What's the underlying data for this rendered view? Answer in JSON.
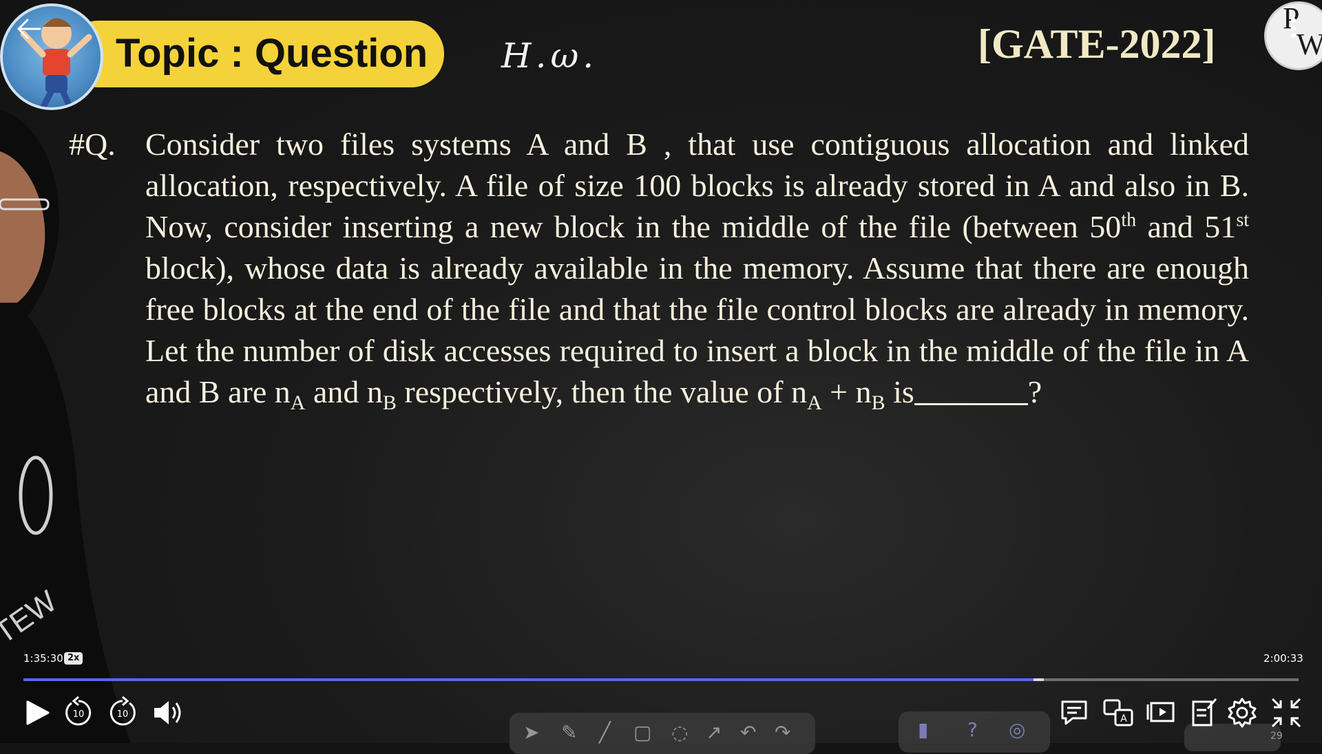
{
  "header": {
    "topic_label": "Topic : Question",
    "handwritten_note": "H.ω.",
    "exam_tag": "[GATE-2022]",
    "logo_letters": {
      "top": "P",
      "bottom": "W"
    }
  },
  "question": {
    "marker": "#Q.",
    "text_1": "Consider two files systems A and B , that use contiguous allocation and linked allocation, respectively. A file of size 100 blocks is already stored in A and also in B. Now, consider inserting a new block in the middle of the file (between 50",
    "sup_1": "th",
    "text_2": " and 51",
    "sup_2": "st",
    "text_3": " block), whose data is already available in the memory. Assume that there are enough free blocks at the end of the file and that the file control blocks are already in memory. Let the number of disk accesses required to insert a block in the middle of the file in A and B are n",
    "sub_a": "A",
    "text_4": " and n",
    "sub_b": "B",
    "text_5": " respectively, then the value of n",
    "sub_a2": "A",
    "text_6": " + n",
    "sub_b2": "B",
    "text_7": " is",
    "text_end": "?"
  },
  "player": {
    "current_time": "1:35:30",
    "speed": "2x",
    "duration": "2:00:33",
    "progress_fraction": 0.792,
    "buffered_fraction": 0.8,
    "skip_back_seconds": "10",
    "skip_forward_seconds": "10",
    "page_number": "29"
  },
  "colors": {
    "topic_pill": "#f4d23a",
    "progress_played": "#5a66ee",
    "board_text": "#f5f0de",
    "gate_text": "#f1e9c4"
  },
  "icons": [
    "back-arrow-icon",
    "kebab-menu-icon",
    "play-icon",
    "rewind-10-icon",
    "forward-10-icon",
    "volume-icon",
    "chat-icon",
    "translate-icon",
    "slides-icon",
    "notes-icon",
    "settings-icon",
    "exit-fullscreen-icon"
  ]
}
